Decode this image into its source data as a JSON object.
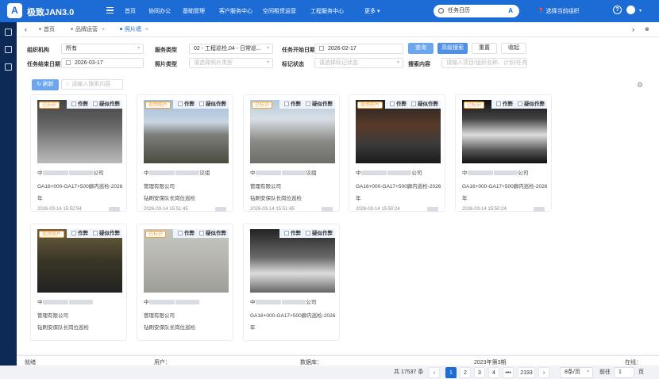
{
  "app": {
    "title": "极致JAN3.0"
  },
  "nav": [
    "首页",
    "协同办公",
    "基础管理",
    "客户服务中心",
    "空间租赁运营",
    "工程服务中心"
  ],
  "more": "更多",
  "search": {
    "value": "任务日历",
    "suffix": "A"
  },
  "location": "选择当前组织",
  "tabs": [
    {
      "label": "首页"
    },
    {
      "label": "品牌运营"
    },
    {
      "label": "照片墙"
    }
  ],
  "filters": {
    "org_label": "组织机构",
    "org_value": "所有",
    "service_label": "服务类型",
    "service_value": "02 - 工程巡检,04 - 日常巡...",
    "start_label": "任务开始日期",
    "start_value": "2026-02-17",
    "end_label": "任务结束日期",
    "end_value": "2026-03-17",
    "photo_label": "照片类型",
    "photo_placeholder": "请选择照片类型",
    "mark_label": "标记状态",
    "mark_placeholder": "请选择标记状态",
    "search_label": "搜索内容",
    "search_placeholder": "请输入项目/组织名称、计划/任务"
  },
  "buttons": {
    "query": "查询",
    "advanced": "高级搜索",
    "reset": "重置",
    "collapse": "收起",
    "refresh": "刷新"
  },
  "list_search_placeholder": "请输入搜索内容",
  "card_ops": {
    "fake": "作弊",
    "suspect": "疑似作弊"
  },
  "cards": [
    {
      "badge": "已标识",
      "line1a": "中",
      "line1b": "公司",
      "line2": "GA16+000-GA17+500廊内巡检-2026",
      "line3": "年",
      "time": "2026-03-14 15:52:54"
    },
    {
      "badge": "现场照片",
      "line1a": "中",
      "line1b": "议组",
      "line2": "管理有限公司",
      "line3": "钻刷安保队长岗位巡检",
      "time": "2026-03-14 15:51:45"
    },
    {
      "badge": "已标识",
      "line1a": "中",
      "line1b": "议组",
      "line2": "管理有限公司",
      "line3": "钻刷安保队长岗位巡检",
      "time": "2026-03-14 15:51:45"
    },
    {
      "badge": "现场照片",
      "line1a": "中",
      "line1b": "公司",
      "line2": "GA16+000-GA17+500廊内巡检-2026",
      "line3": "年",
      "time": "2026-03-14 15:50:24"
    },
    {
      "badge": "已标识",
      "line1a": "中",
      "line1b": "公司",
      "line2": "GA16+000-GA17+500廊内巡检-2026",
      "line3": "年",
      "time": "2026-03-14 15:50:24"
    },
    {
      "badge": "现场照片",
      "line1a": "中",
      "line1b": "",
      "line2": "管理有限公司",
      "line3": "钻刷安保队长岗位巡检",
      "time": ""
    },
    {
      "badge": "已标识",
      "line1a": "中",
      "line1b": "",
      "line2": "管理有限公司",
      "line3": "钻刷安保队长岗位巡检",
      "time": ""
    },
    {
      "badge": "",
      "line1a": "中",
      "line1b": "公司",
      "line2": "GA16+000-GA17+500廊内巡检-2026",
      "line3": "年",
      "time": ""
    }
  ],
  "pagination": {
    "total": "共 17537 条",
    "pages": [
      "1",
      "2",
      "3",
      "4",
      "•••",
      "2193"
    ],
    "size": "8条/页",
    "goto": "前往",
    "goto_value": "1",
    "goto_suffix": "页"
  },
  "status": {
    "ready": "就绪",
    "user": "用户：",
    "db": "数据库：",
    "period": "2023年第3期",
    "online": "在线："
  },
  "colors": {
    "primary": "#1d6cd6",
    "sidebar": "#0c2a55",
    "badge": "#f0a23c"
  }
}
